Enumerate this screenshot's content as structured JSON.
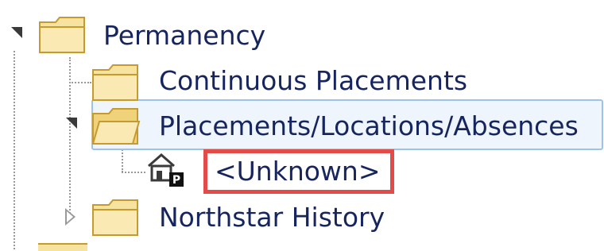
{
  "tree": {
    "root": {
      "label": "Permanency"
    },
    "children": [
      {
        "label": "Continuous Placements"
      },
      {
        "label": "Placements/Locations/Absences",
        "child": {
          "label": "<Unknown>",
          "badge": "P"
        }
      },
      {
        "label": "Northstar History"
      }
    ]
  },
  "colors": {
    "text": "#17255f",
    "selection_bg": "#eef5fc",
    "selection_border": "#9ec3ea",
    "highlight_border": "#e34b4b",
    "folder_fill": "#f8e39a",
    "folder_border": "#c49a2e"
  },
  "icons": [
    "expand-arrow-icon",
    "folder-icon",
    "folder-open-icon",
    "house-p-icon",
    "collapsed-arrow-icon"
  ]
}
